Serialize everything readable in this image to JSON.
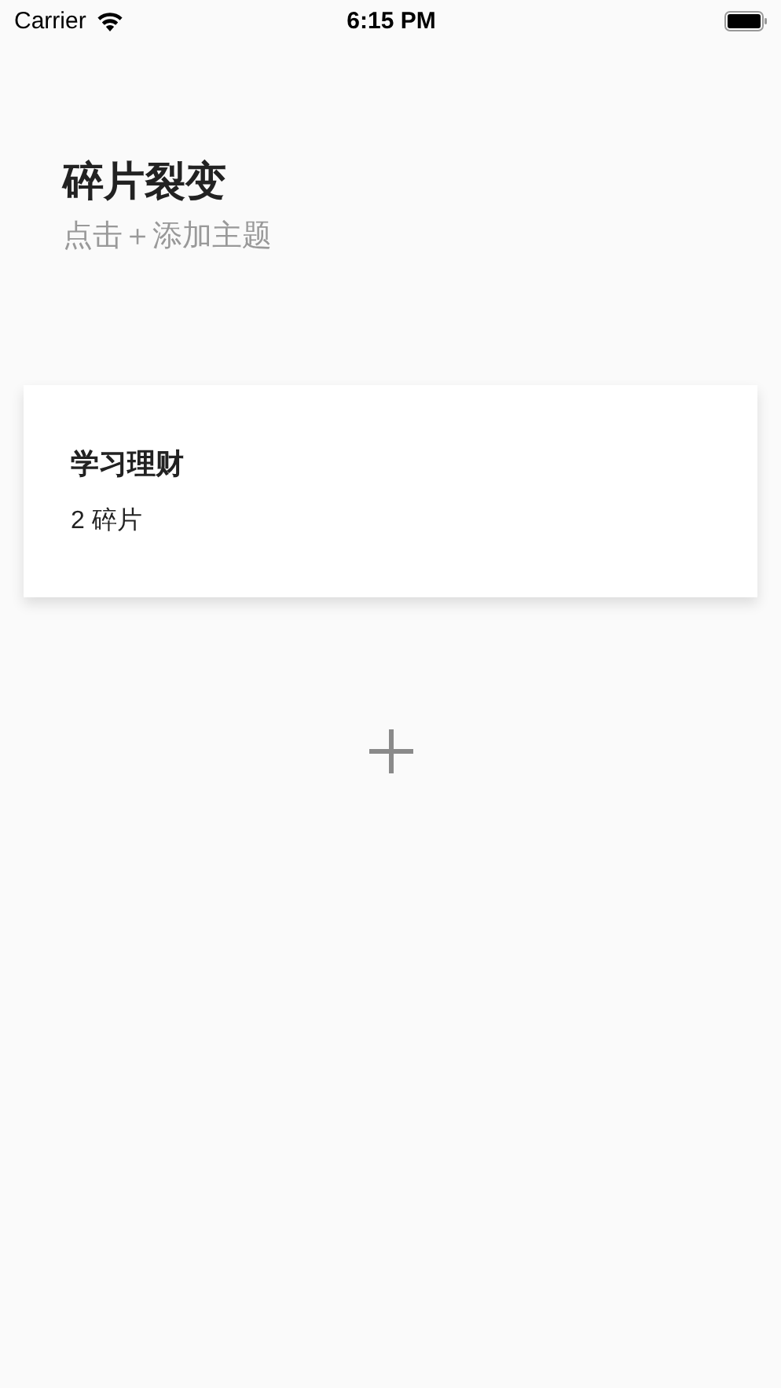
{
  "status_bar": {
    "carrier": "Carrier",
    "time": "6:15 PM"
  },
  "header": {
    "title": "碎片裂变",
    "subtitle": "点击＋添加主题"
  },
  "topics": [
    {
      "title": "学习理财",
      "count": "2 碎片"
    }
  ]
}
